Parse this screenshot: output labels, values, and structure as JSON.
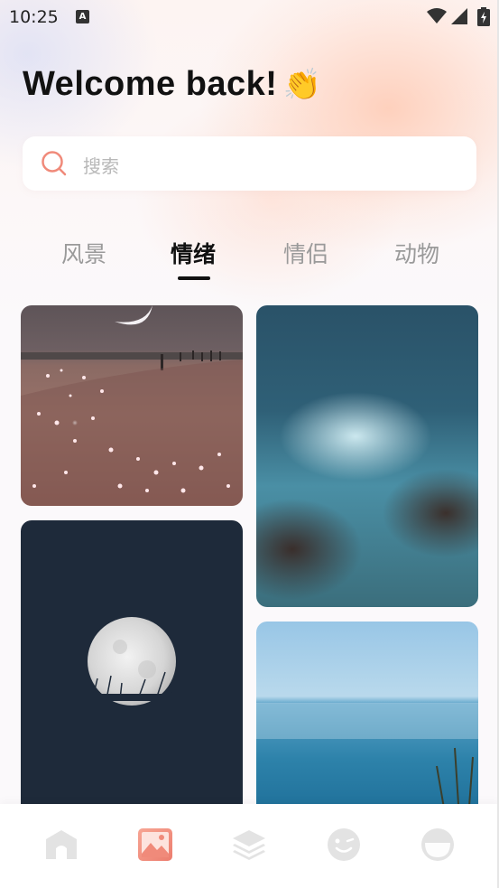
{
  "status_bar": {
    "time": "10:25",
    "notification_icon": "a-box-icon",
    "wifi_icon": "wifi-icon",
    "signal_icon": "signal-icon",
    "battery_icon": "battery-charging-icon"
  },
  "header": {
    "greeting": "Welcome back!",
    "emoji": "👏"
  },
  "search": {
    "placeholder": "搜索",
    "icon": "search-icon"
  },
  "tabs": [
    {
      "label": "风景",
      "active": false
    },
    {
      "label": "情绪",
      "active": true
    },
    {
      "label": "情侣",
      "active": false
    },
    {
      "label": "动物",
      "active": false
    }
  ],
  "gallery": [
    {
      "subject": "beach-at-night-with-crescent-moon"
    },
    {
      "subject": "ocean-waves-on-rocks"
    },
    {
      "subject": "full-moon-over-grass"
    },
    {
      "subject": "calm-sea-horizon"
    }
  ],
  "bottom_nav": [
    {
      "icon": "home-icon",
      "active": false
    },
    {
      "icon": "image-icon",
      "active": true
    },
    {
      "icon": "layers-icon",
      "active": false
    },
    {
      "icon": "smiley-icon",
      "active": false
    },
    {
      "icon": "profile-icon",
      "active": false
    }
  ],
  "colors": {
    "accent": "#f08a7a",
    "inactive_icon": "#e3e3e3",
    "tab_inactive": "#9a9a9a",
    "tab_active": "#111111"
  }
}
